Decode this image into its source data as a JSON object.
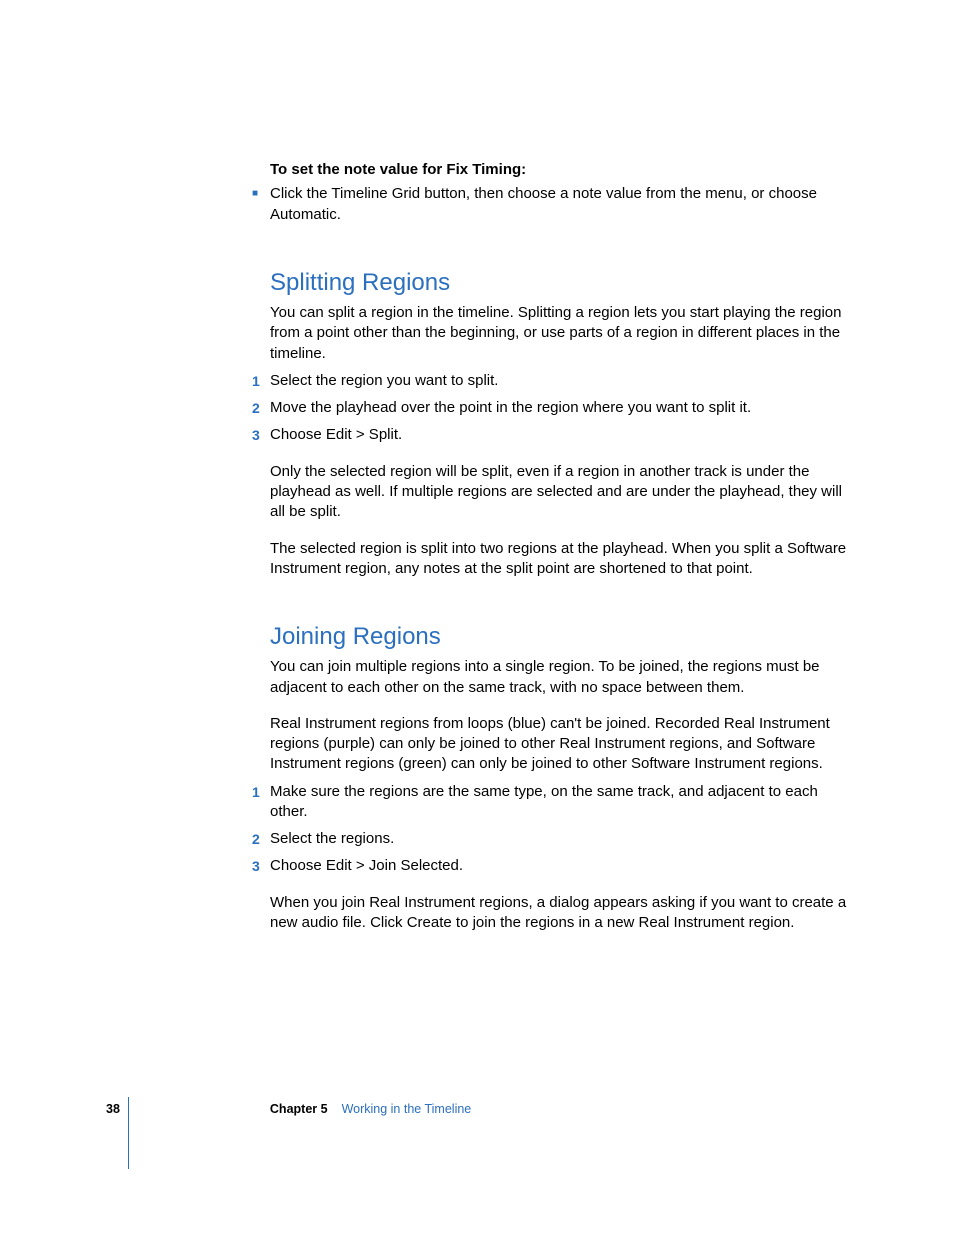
{
  "fixTiming": {
    "heading": "To set the note value for Fix Timing:",
    "bullet": "Click the Timeline Grid button, then choose a note value from the menu, or choose Automatic."
  },
  "splitting": {
    "heading": "Splitting Regions",
    "intro": "You can split a region in the timeline. Splitting a region lets you start playing the region from a point other than the beginning, or use parts of a region in different places in the timeline.",
    "steps": [
      "Select the region you want to split.",
      "Move the playhead over the point in the region where you want to split it.",
      "Choose Edit > Split."
    ],
    "after1": "Only the selected region will be split, even if a region in another track is under the playhead as well. If multiple regions are selected and are under the playhead, they will all be split.",
    "after2": "The selected region is split into two regions at the playhead. When you split a Software Instrument region, any notes at the split point are shortened to that point."
  },
  "joining": {
    "heading": "Joining Regions",
    "intro1": "You can join multiple regions into a single region. To be joined, the regions must be adjacent to each other on the same track, with no space between them.",
    "intro2": "Real Instrument regions from loops (blue) can't be joined. Recorded Real Instrument regions (purple) can only be joined to other Real Instrument regions, and Software Instrument regions (green) can only be joined to other Software Instrument regions.",
    "steps": [
      "Make sure the regions are the same type, on the same track, and adjacent to each other.",
      "Select the regions.",
      "Choose Edit > Join Selected."
    ],
    "after": "When you join Real Instrument regions, a dialog appears asking if you want to create a new audio file. Click Create to join the regions in a new Real Instrument region."
  },
  "footer": {
    "page": "38",
    "chapterLabel": "Chapter 5",
    "chapterTitle": "Working in the Timeline"
  },
  "nums": {
    "n1": "1",
    "n2": "2",
    "n3": "3"
  }
}
